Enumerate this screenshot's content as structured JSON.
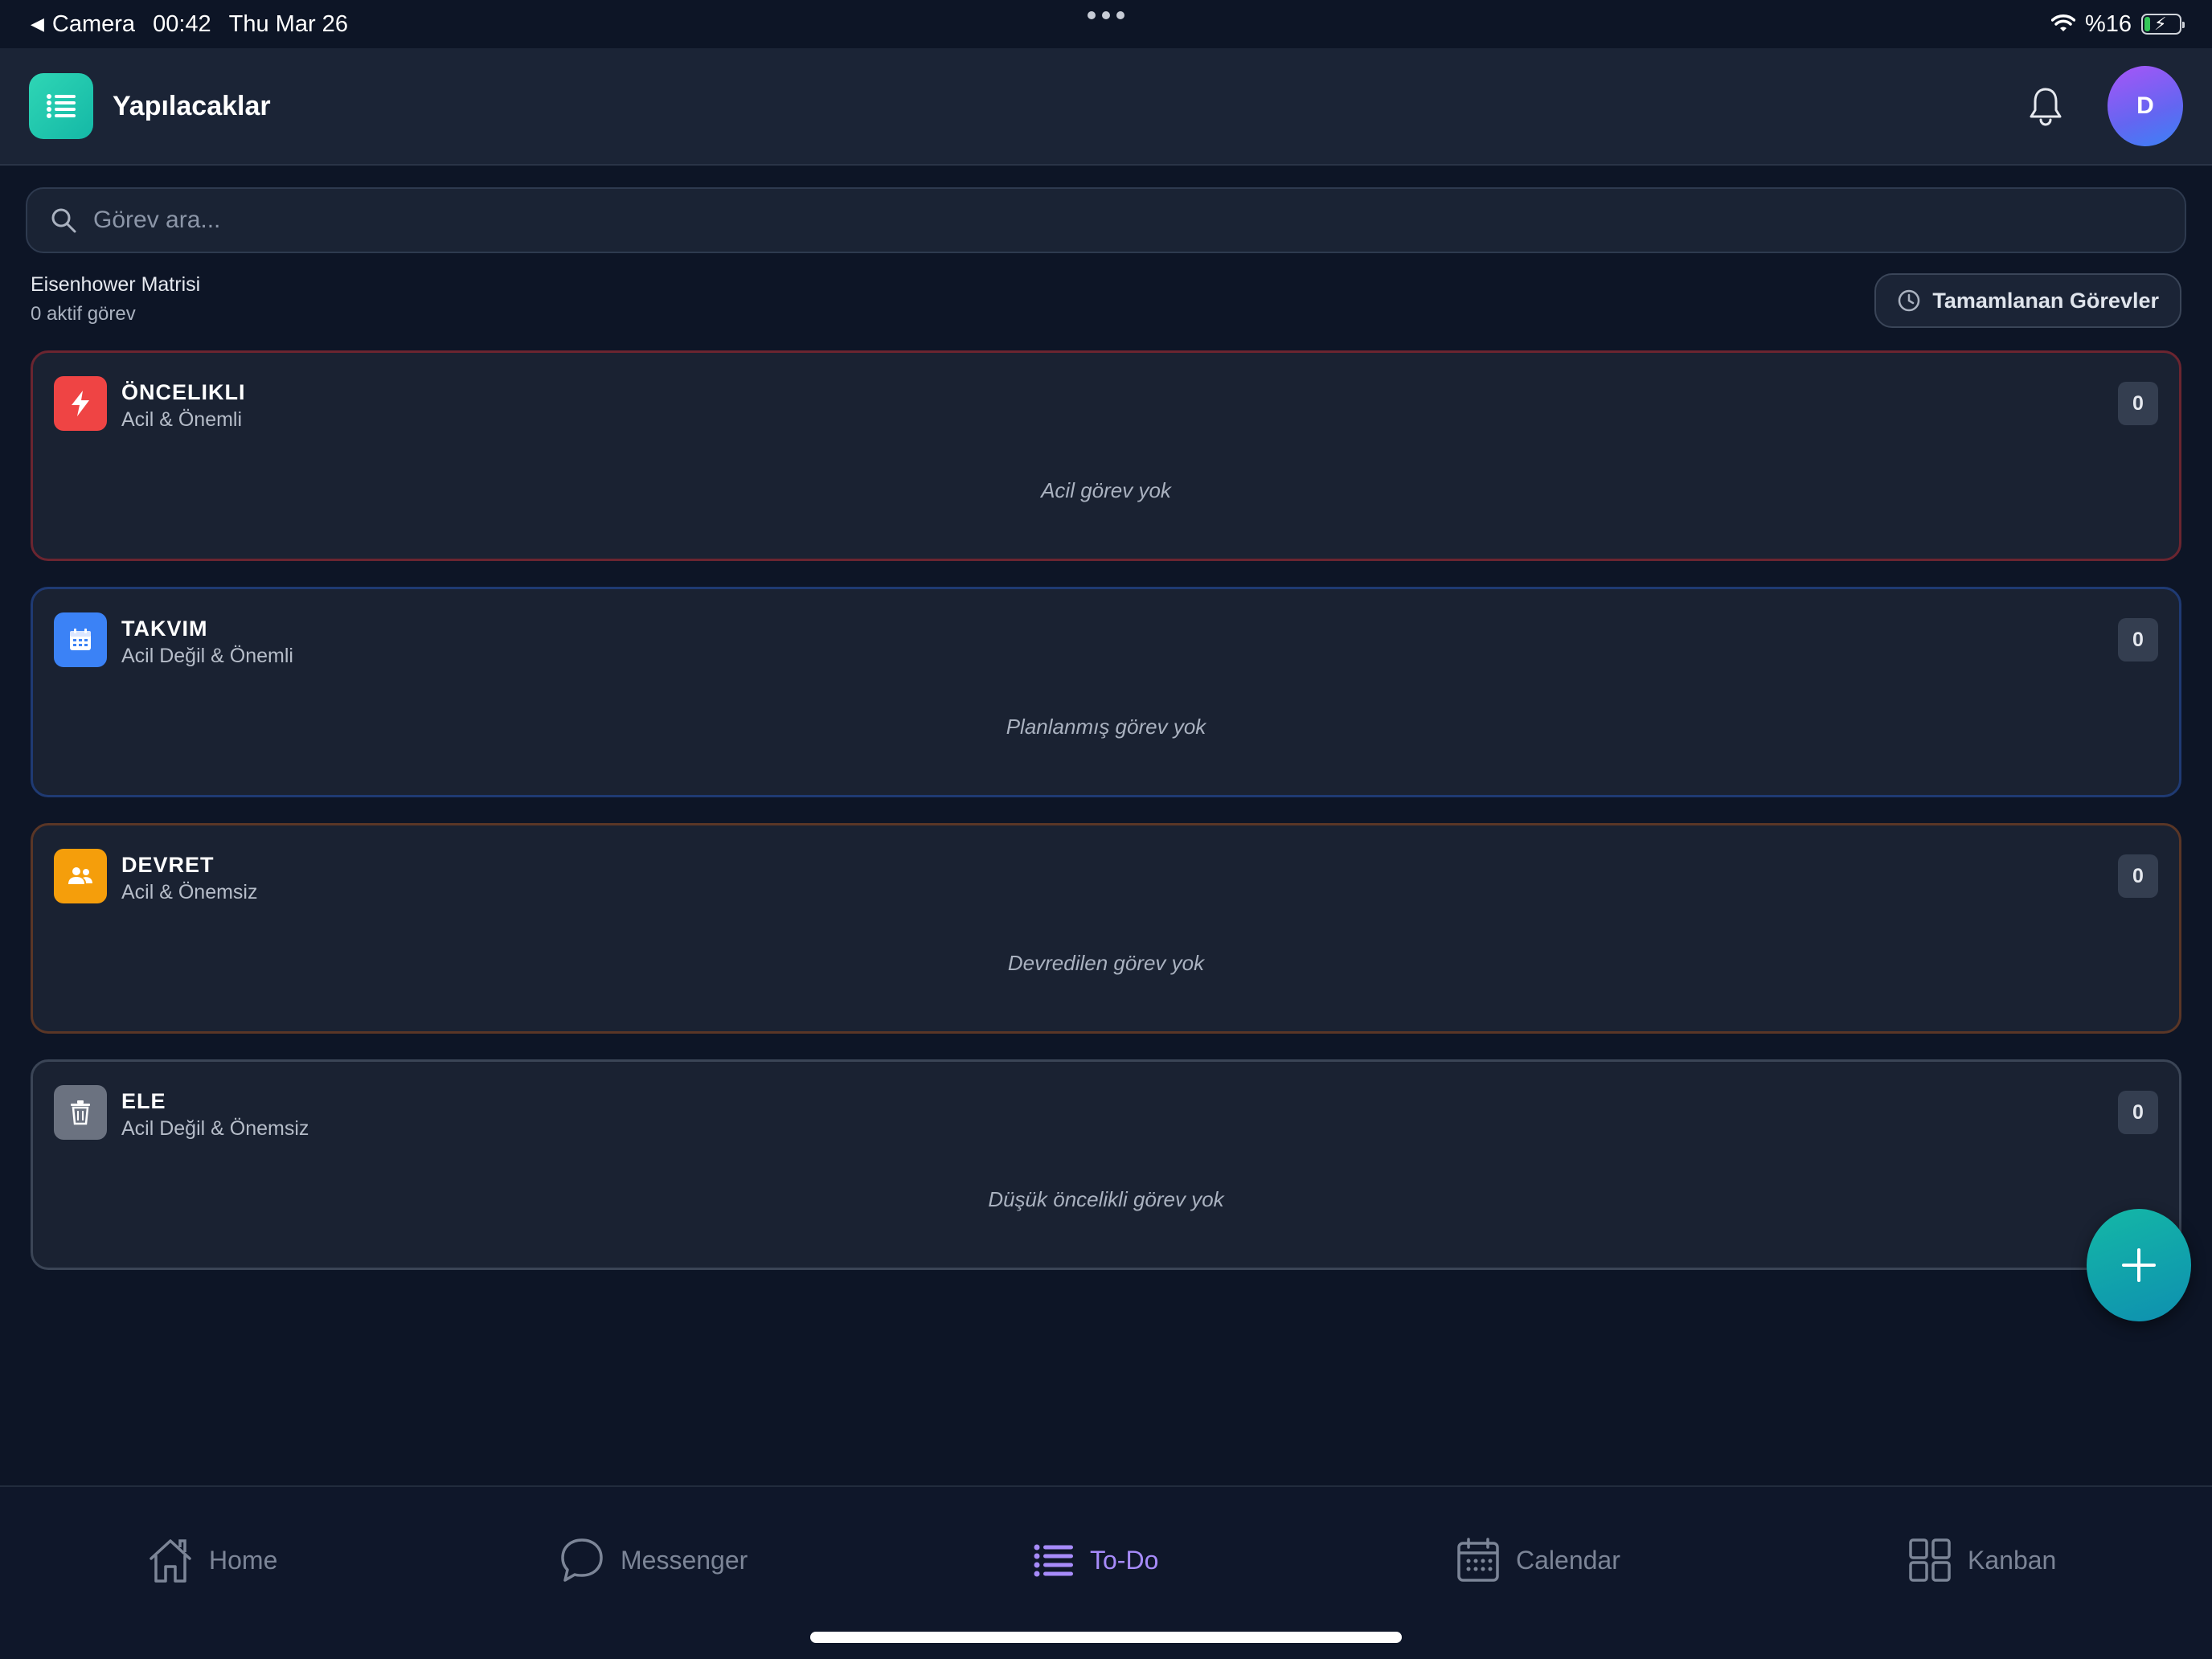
{
  "status_bar": {
    "back_app": "Camera",
    "time": "00:42",
    "date": "Thu Mar 26",
    "battery": "%16",
    "battery_level": 0.16
  },
  "header": {
    "title": "Yapılacaklar",
    "avatar_initial": "D",
    "logo_icon": "list-icon",
    "bell_icon": "bell-icon"
  },
  "search": {
    "placeholder": "Görev ara...",
    "value": ""
  },
  "section": {
    "title": "Eisenhower Matrisi",
    "count_text": "0 aktif görev",
    "completed_button": "Tamamlanan Görevler"
  },
  "quadrants": [
    {
      "title": "ÖNCELIKLI",
      "subtitle": "Acil & Önemli",
      "count": "0",
      "empty": "Acil görev yok",
      "icon": "lightning-icon",
      "icon_color": "#ef4444",
      "border_color": "#6b2530"
    },
    {
      "title": "TAKVIM",
      "subtitle": "Acil Değil & Önemli",
      "count": "0",
      "empty": "Planlanmış görev yok",
      "icon": "calendar-icon",
      "icon_color": "#3b82f6",
      "border_color": "#1f3a73"
    },
    {
      "title": "DEVRET",
      "subtitle": "Acil & Önemsiz",
      "count": "0",
      "empty": "Devredilen görev yok",
      "icon": "users-icon",
      "icon_color": "#f59e0b",
      "border_color": "#5a3626"
    },
    {
      "title": "ELE",
      "subtitle": "Acil Değil & Önemsiz",
      "count": "0",
      "empty": "Düşük öncelikli görev yok",
      "icon": "trash-icon",
      "icon_color": "#6b7280",
      "border_color": "#3b4556"
    }
  ],
  "tabs": [
    {
      "label": "Home",
      "icon": "home-icon",
      "active": false
    },
    {
      "label": "Messenger",
      "icon": "chat-bubble-icon",
      "active": false
    },
    {
      "label": "To-Do",
      "icon": "list-icon",
      "active": true
    },
    {
      "label": "Calendar",
      "icon": "calendar-icon",
      "active": false
    },
    {
      "label": "Kanban",
      "icon": "grid-icon",
      "active": false
    }
  ],
  "colors": {
    "accent": "#14b8a6",
    "active_tab": "#a78bfa",
    "background": "#0d1526"
  }
}
